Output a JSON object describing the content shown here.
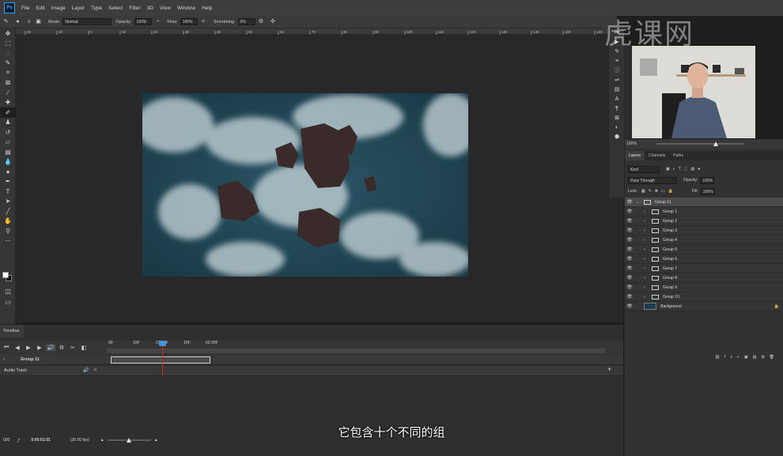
{
  "app": {
    "logo": "Ps"
  },
  "menu": [
    "File",
    "Edit",
    "Image",
    "Layer",
    "Type",
    "Select",
    "Filter",
    "3D",
    "View",
    "Window",
    "Help"
  ],
  "options_bar": {
    "brush_size": "9",
    "mode_label": "Mode:",
    "mode_value": "Normal",
    "opacity_label": "Opacity:",
    "opacity_value": "100%",
    "flow_label": "Flow:",
    "flow_value": "100%",
    "smoothing_label": "Smoothing:",
    "smoothing_value": "0%"
  },
  "ruler_ticks": [
    "20",
    "10",
    "0",
    "10",
    "20",
    "30",
    "40",
    "50",
    "60",
    "70",
    "80",
    "90",
    "100",
    "110",
    "120",
    "130",
    "140",
    "150",
    "160"
  ],
  "timeline": {
    "panel_title": "Timeline",
    "time_labels": [
      "00",
      "15F",
      "01:00F",
      "15F",
      "02:00F"
    ],
    "tracks": [
      {
        "name": "Group 11"
      },
      {
        "name": "Audio Track"
      }
    ],
    "current_time": "0:00:01:01",
    "fps": "(30.00 fps)",
    "frame_field": "000"
  },
  "watermark_text": "虎课网",
  "layers_panel": {
    "zoom": "100%",
    "tabs": [
      "Layers",
      "Channels",
      "Paths"
    ],
    "filter_label": "Kind",
    "blend_mode": "Pass Through",
    "opacity_label": "Opacity:",
    "opacity_value": "100%",
    "lock_label": "Lock:",
    "fill_label": "Fill:",
    "fill_value": "100%",
    "layers": [
      {
        "name": "Group 11",
        "type": "group",
        "expanded": true,
        "selected": true
      },
      {
        "name": "Group 1",
        "type": "group"
      },
      {
        "name": "Group 2",
        "type": "group"
      },
      {
        "name": "Group 3",
        "type": "group"
      },
      {
        "name": "Group 4",
        "type": "group"
      },
      {
        "name": "Group 5",
        "type": "group"
      },
      {
        "name": "Group 6",
        "type": "group"
      },
      {
        "name": "Group 7",
        "type": "group"
      },
      {
        "name": "Group 8",
        "type": "group"
      },
      {
        "name": "Group 9",
        "type": "group"
      },
      {
        "name": "Group 10",
        "type": "group"
      },
      {
        "name": "Background",
        "type": "image"
      }
    ]
  },
  "subtitle": "它包含十个不同的组",
  "colors": {
    "accent": "#2ea2ff",
    "playhead": "#e02020",
    "ocean": "#1a3d50"
  }
}
